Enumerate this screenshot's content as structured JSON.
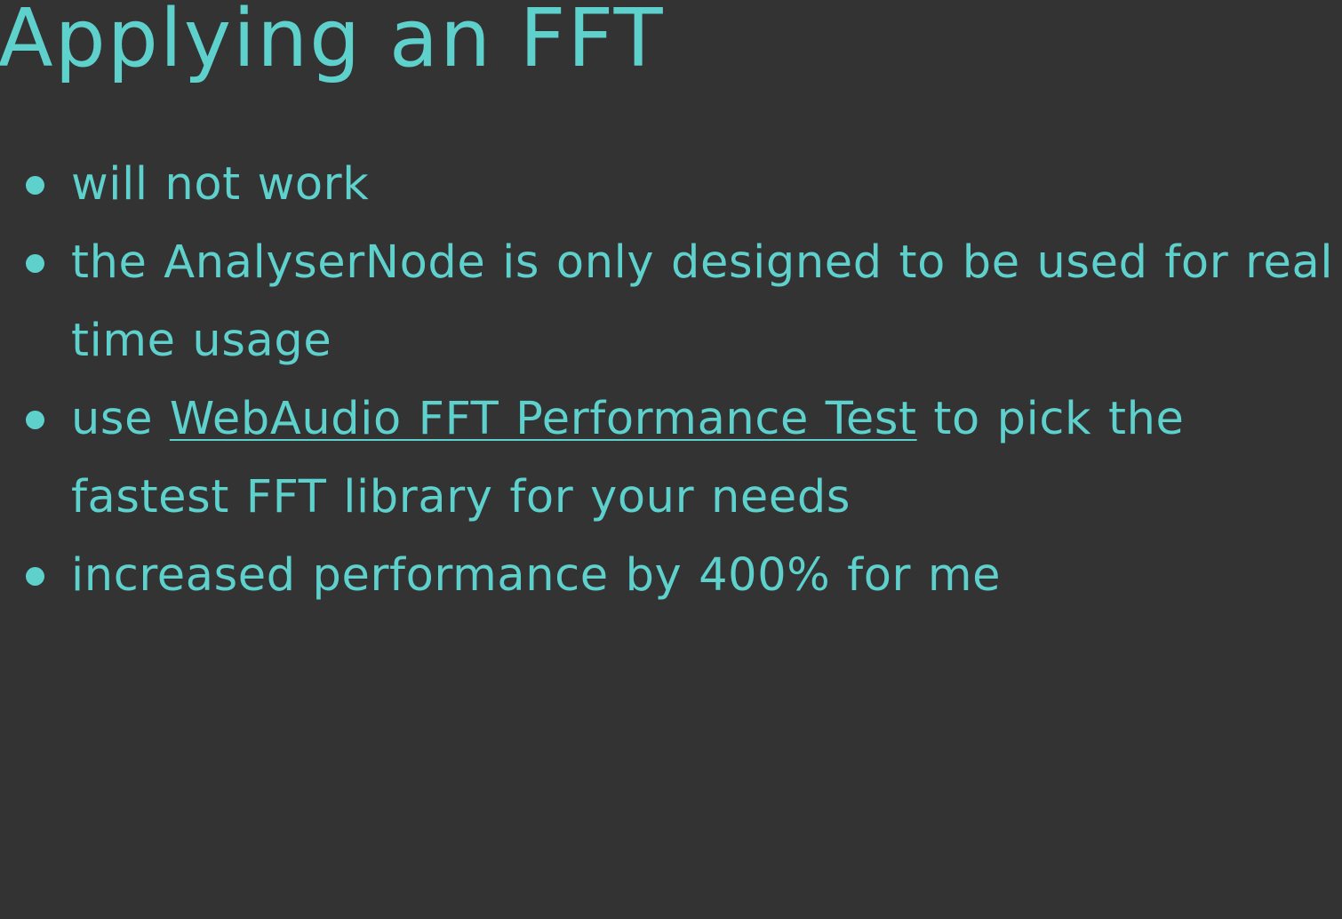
{
  "theme": {
    "background": "#333333",
    "accent": "#5ed1cd"
  },
  "slide": {
    "title": "Applying an FFT",
    "bullets": [
      {
        "text": "will not work"
      },
      {
        "text": "the AnalyserNode is only designed to be used for real time usage"
      },
      {
        "before": "use ",
        "link_text": "WebAudio FFT Performance Test",
        "after": " to pick the fastest FFT library for your needs"
      },
      {
        "text": "increased performance by 400% for me"
      }
    ]
  }
}
